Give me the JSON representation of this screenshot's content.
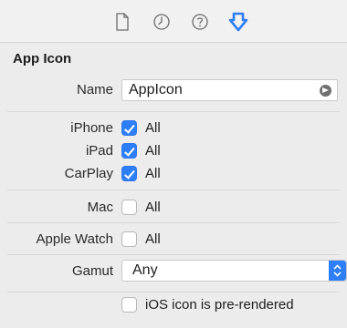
{
  "icons": {
    "file": "file-inspector-icon",
    "history": "history-inspector-icon",
    "help": "quick-help-icon",
    "attributes": "attributes-inspector-icon"
  },
  "colors": {
    "accent": "#2d7ff9",
    "panel": "#ececec"
  },
  "section": {
    "title": "App Icon"
  },
  "name_row": {
    "label": "Name",
    "value": "AppIcon"
  },
  "devices": [
    {
      "label": "iPhone",
      "option": "All",
      "checked": true
    },
    {
      "label": "iPad",
      "option": "All",
      "checked": true
    },
    {
      "label": "CarPlay",
      "option": "All",
      "checked": true
    }
  ],
  "mac": {
    "label": "Mac",
    "option": "All",
    "checked": false
  },
  "watch": {
    "label": "Apple Watch",
    "option": "All",
    "checked": false
  },
  "gamut": {
    "label": "Gamut",
    "value": "Any"
  },
  "prerendered": {
    "label": "iOS icon is pre-rendered",
    "checked": false
  }
}
